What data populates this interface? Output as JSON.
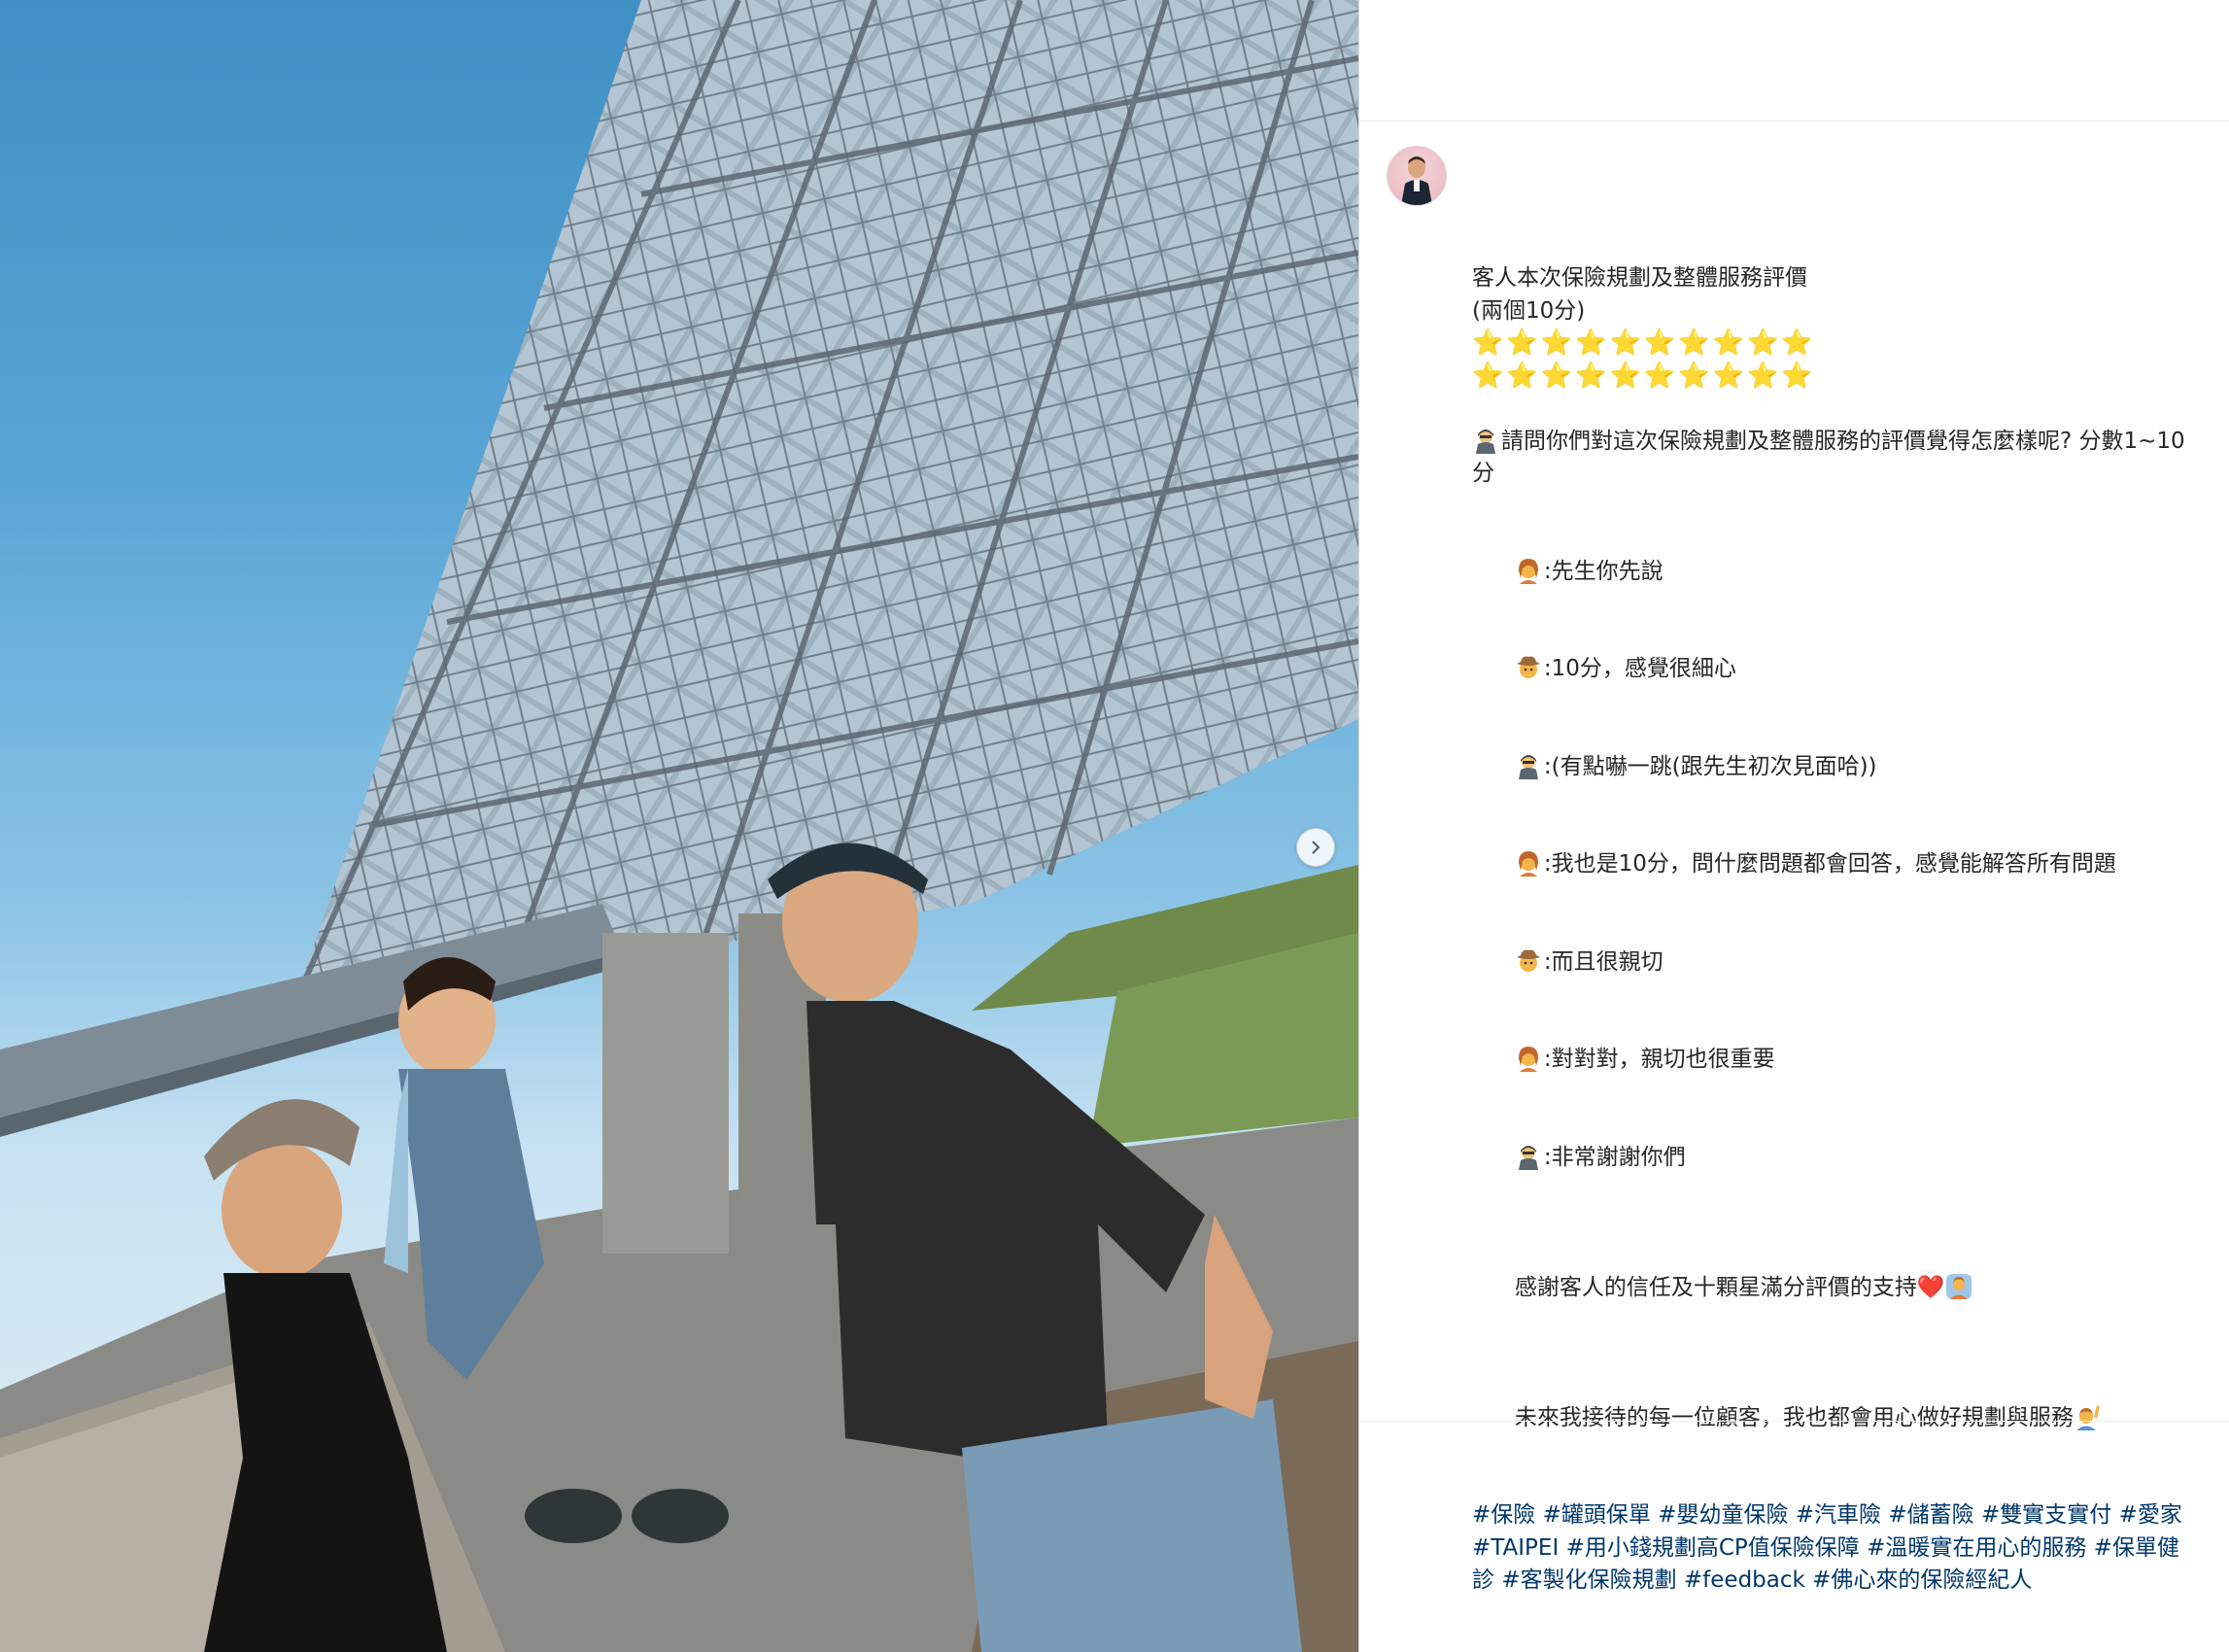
{
  "post": {
    "image": {
      "description_icon": "photo",
      "next_icon": "chevron-right-icon"
    },
    "author": {
      "avatar_icon": "avatar-photo"
    },
    "caption": {
      "line1": "客人本次保險規劃及整體服務評價",
      "line2": "(兩個10分)",
      "stars_row1": "⭐⭐⭐⭐⭐⭐⭐⭐⭐⭐",
      "stars_row2": "⭐⭐⭐⭐⭐⭐⭐⭐⭐⭐",
      "question": "請問你們對這次保險規劃及整體服務的評價覺得怎麼樣呢? 分數1~10分",
      "dialog": [
        {
          "speaker_icon": "woman-emoji",
          "text": ":先生你先說"
        },
        {
          "speaker_icon": "cowboy-emoji",
          "text": ":10分，感覺很細心"
        },
        {
          "speaker_icon": "agent-emoji",
          "text": ":(有點嚇一跳(跟先生初次見面哈))"
        },
        {
          "speaker_icon": "woman-emoji",
          "text": ":我也是10分，問什麼問題都會回答，感覺能解答所有問題"
        },
        {
          "speaker_icon": "cowboy-emoji",
          "text": ":而且很親切"
        },
        {
          "speaker_icon": "woman-emoji",
          "text": ":對對對，親切也很重要"
        },
        {
          "speaker_icon": "agent-emoji",
          "text": ":非常謝謝你們"
        }
      ],
      "thanks": "感謝客人的信任及十顆星滿分評價的支持",
      "thanks_heart": "❤️",
      "promise": "未來我接待的每一位顧客，我也都會用心做好規劃與服務",
      "hashtags": [
        "#保險",
        "#罐頭保單",
        "#嬰幼童保險",
        "#汽車險",
        "#儲蓄險",
        "#雙實支實付",
        "#愛家",
        "#TAIPEI",
        "#用小錢規劃高CP值保險保障",
        "#溫暖實在用心的服務",
        "#保單健診",
        "#客製化保險規劃",
        "#feedback",
        "#佛心來的保險經紀人"
      ]
    }
  },
  "colors": {
    "text": "#262626",
    "hashtag": "#00376b",
    "star": "#f5b800",
    "heart": "#e0202e",
    "divider": "#efefef"
  }
}
